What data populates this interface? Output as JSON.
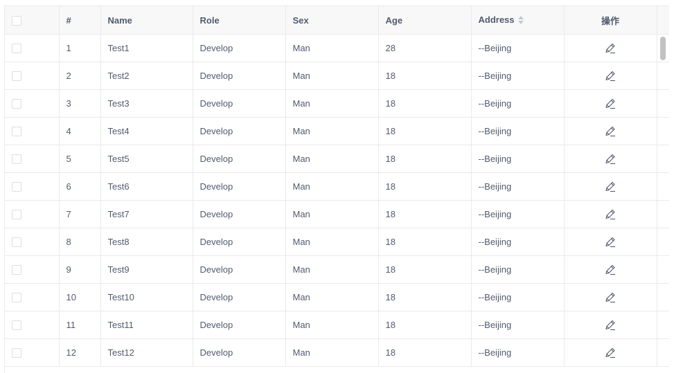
{
  "table": {
    "columns": {
      "index": "#",
      "name": "Name",
      "role": "Role",
      "sex": "Sex",
      "age": "Age",
      "address": "Address",
      "action": "操作"
    },
    "rows": [
      {
        "index": "1",
        "name": "Test1",
        "role": "Develop",
        "sex": "Man",
        "age": "28",
        "address": "--Beijing"
      },
      {
        "index": "2",
        "name": "Test2",
        "role": "Develop",
        "sex": "Man",
        "age": "18",
        "address": "--Beijing"
      },
      {
        "index": "3",
        "name": "Test3",
        "role": "Develop",
        "sex": "Man",
        "age": "18",
        "address": "--Beijing"
      },
      {
        "index": "4",
        "name": "Test4",
        "role": "Develop",
        "sex": "Man",
        "age": "18",
        "address": "--Beijing"
      },
      {
        "index": "5",
        "name": "Test5",
        "role": "Develop",
        "sex": "Man",
        "age": "18",
        "address": "--Beijing"
      },
      {
        "index": "6",
        "name": "Test6",
        "role": "Develop",
        "sex": "Man",
        "age": "18",
        "address": "--Beijing"
      },
      {
        "index": "7",
        "name": "Test7",
        "role": "Develop",
        "sex": "Man",
        "age": "18",
        "address": "--Beijing"
      },
      {
        "index": "8",
        "name": "Test8",
        "role": "Develop",
        "sex": "Man",
        "age": "18",
        "address": "--Beijing"
      },
      {
        "index": "9",
        "name": "Test9",
        "role": "Develop",
        "sex": "Man",
        "age": "18",
        "address": "--Beijing"
      },
      {
        "index": "10",
        "name": "Test10",
        "role": "Develop",
        "sex": "Man",
        "age": "18",
        "address": "--Beijing"
      },
      {
        "index": "11",
        "name": "Test11",
        "role": "Develop",
        "sex": "Man",
        "age": "18",
        "address": "--Beijing"
      },
      {
        "index": "12",
        "name": "Test12",
        "role": "Develop",
        "sex": "Man",
        "age": "18",
        "address": "--Beijing"
      }
    ],
    "row_action_icon": "edit-pencil-icon",
    "header_sort_icon": "sort-icon"
  },
  "colors": {
    "header_bg": "#f8f8f9",
    "border": "#e8eaec",
    "text": "#515a6e",
    "scrollbar": "#c1c1c1"
  }
}
